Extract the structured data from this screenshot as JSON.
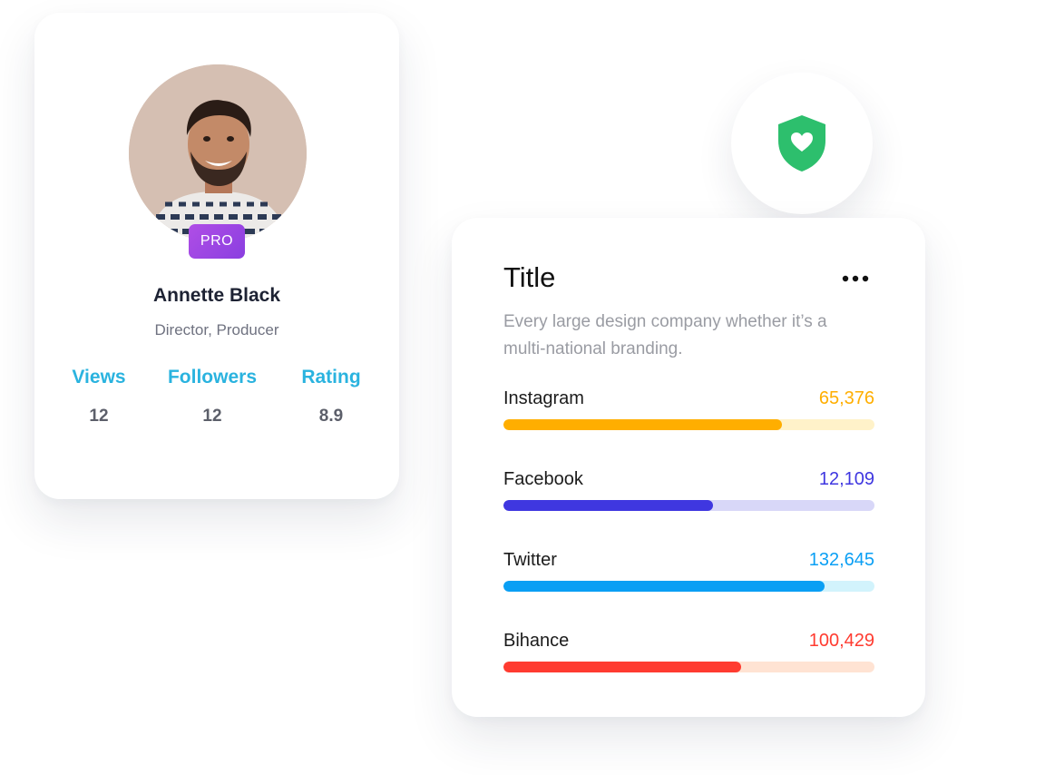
{
  "profile": {
    "badge": "PRO",
    "name": "Annette Black",
    "role": "Director, Producer",
    "stats": [
      {
        "label": "Views",
        "value": "12"
      },
      {
        "label": "Followers",
        "value": "12"
      },
      {
        "label": "Rating",
        "value": "8.9"
      }
    ]
  },
  "shield": {
    "icon": "shield-heart-icon",
    "color": "#2dbf6d"
  },
  "card": {
    "title": "Title",
    "description": "Every large design company whether it’s a multi-national branding.",
    "metrics": [
      {
        "label": "Instagram",
        "value": "65,376",
        "color": "#ffae00",
        "track": "#fff2c9",
        "fill": 0.75
      },
      {
        "label": "Facebook",
        "value": "12,109",
        "color": "#3f37e0",
        "track": "#d8d7f8",
        "fill": 0.565
      },
      {
        "label": "Twitter",
        "value": "132,645",
        "color": "#0a9ff4",
        "track": "#d2f3fc",
        "fill": 0.865
      },
      {
        "label": "Bihance",
        "value": "100,429",
        "color": "#ff3b30",
        "track": "#ffe3d3",
        "fill": 0.64
      }
    ]
  }
}
